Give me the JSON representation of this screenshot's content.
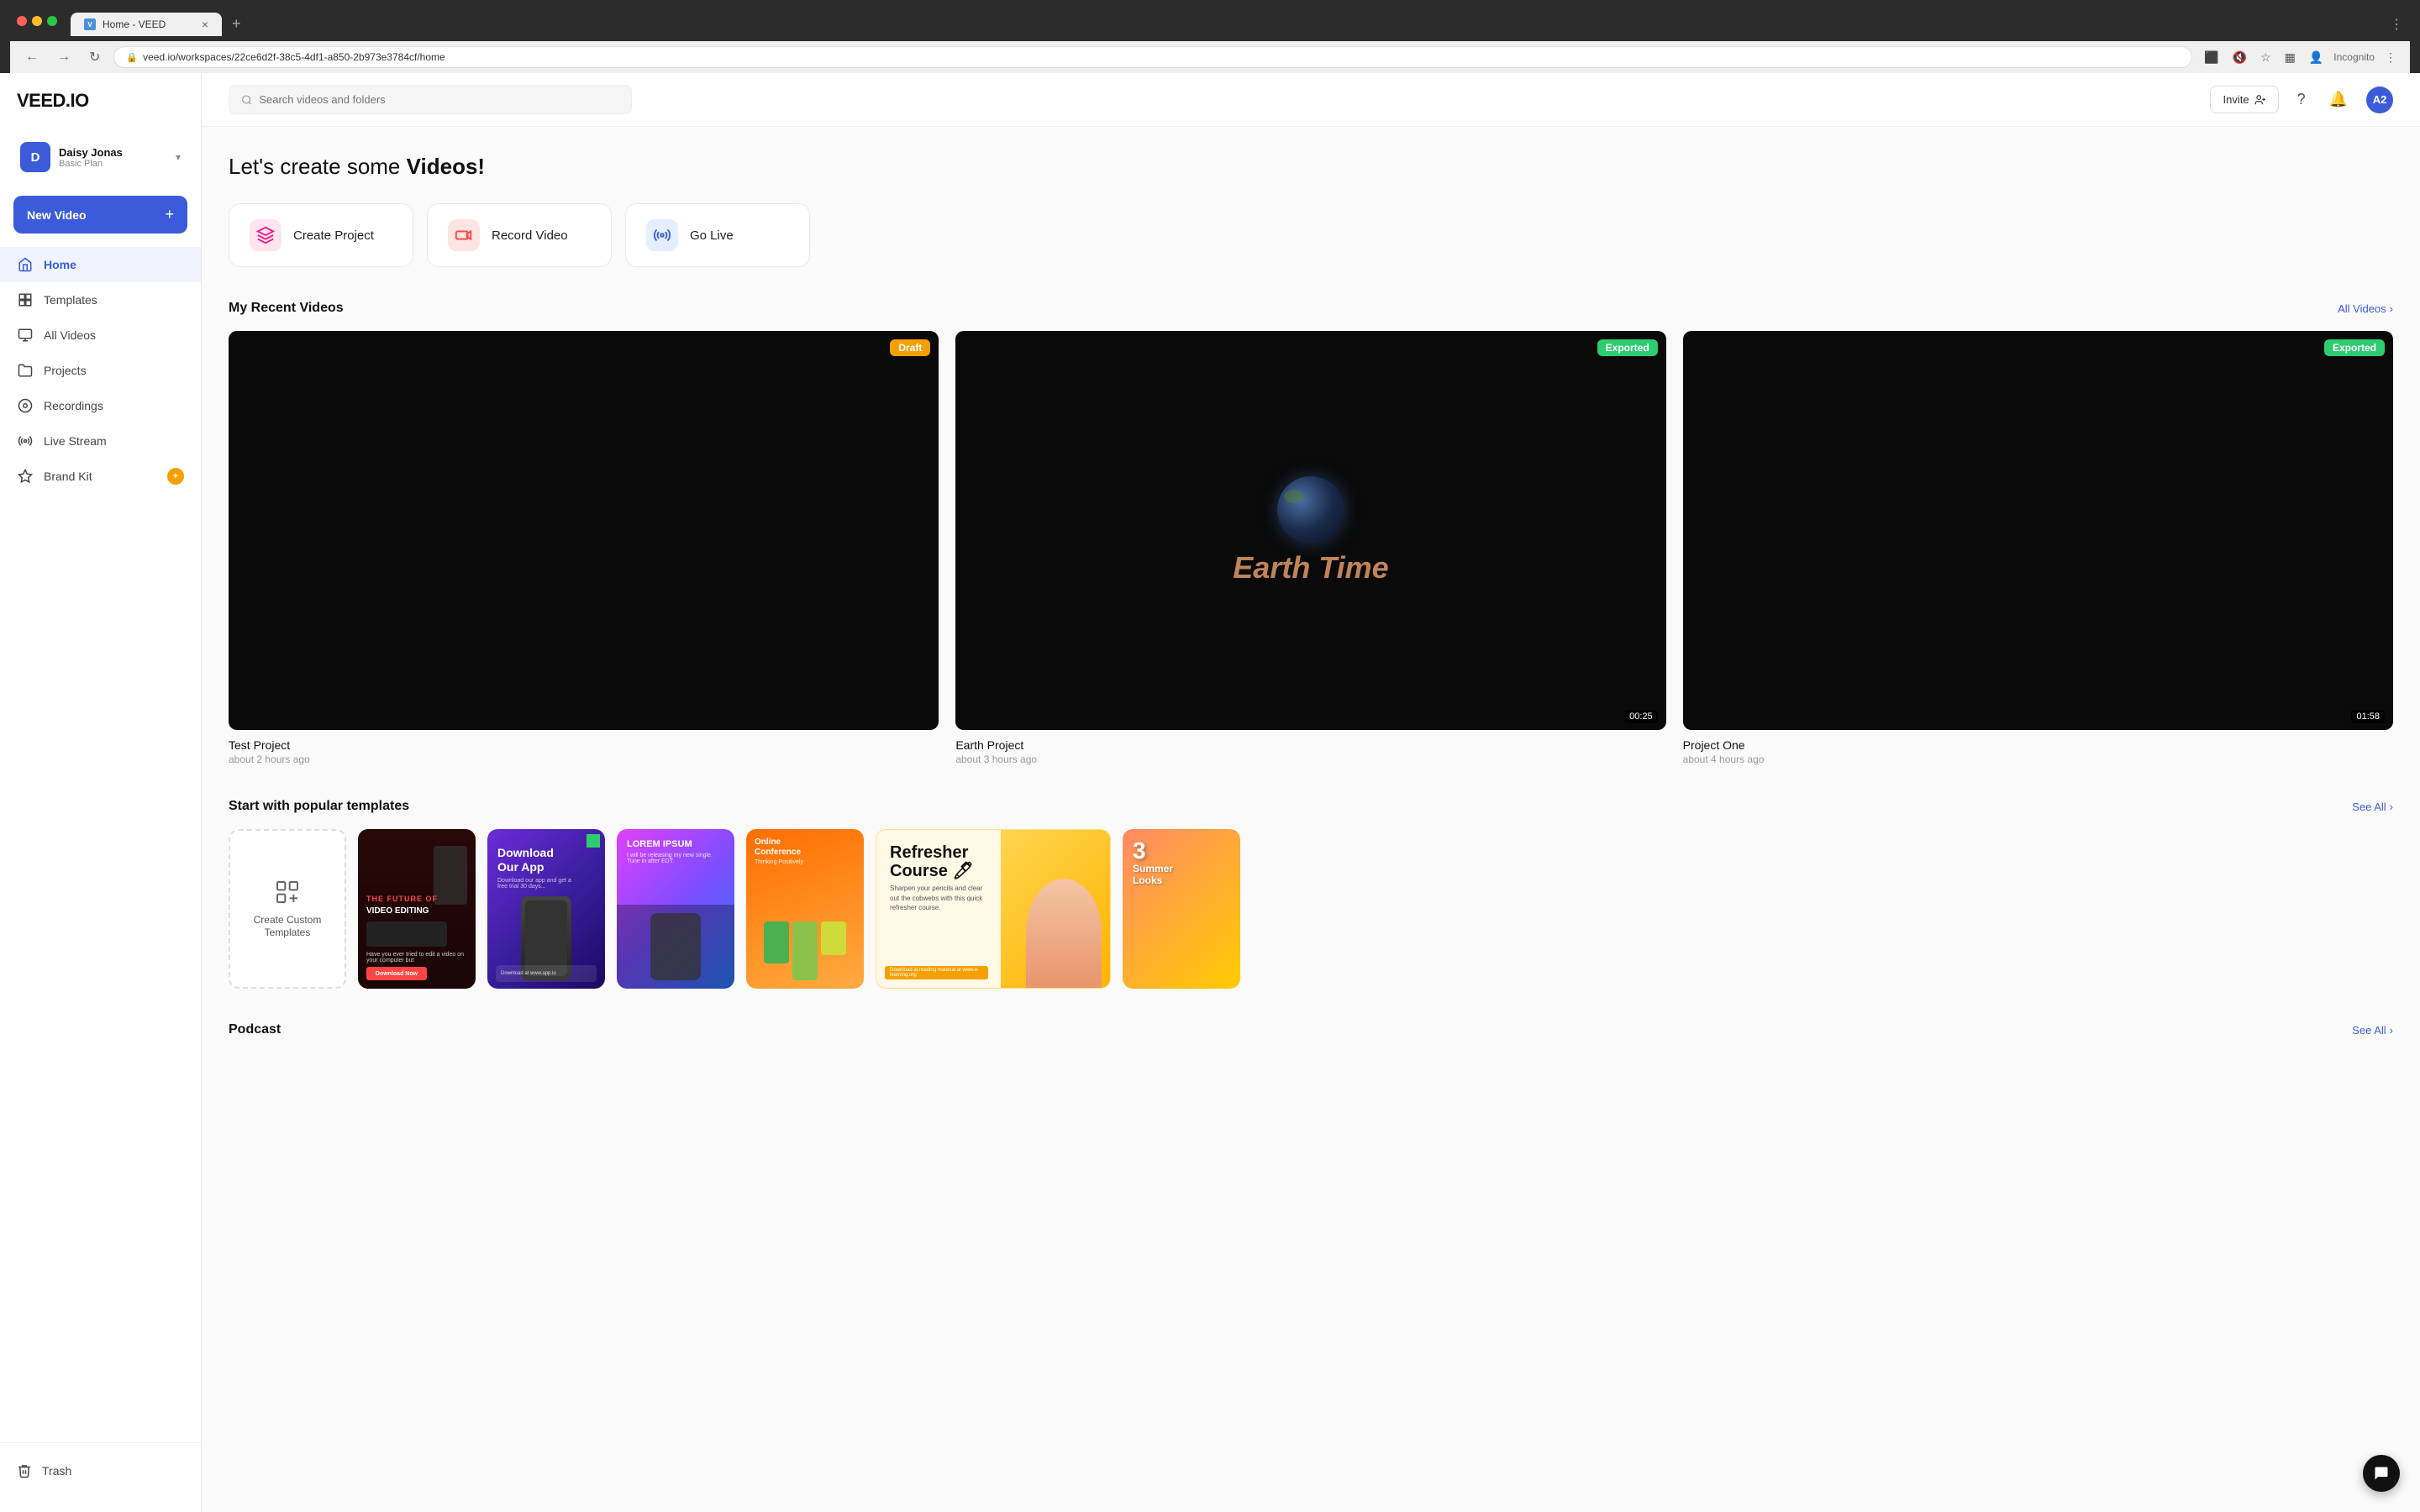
{
  "browser": {
    "tab_label": "Home - VEED",
    "tab_favicon": "V",
    "url": "veed.io/workspaces/22ce6d2f-38c5-4df1-a850-2b973e3784cf/home",
    "url_full": "https://veed.io/workspaces/22ce6d2f-38c5-4df1-a850-2b973e3784cf/home",
    "incognito_label": "Incognito"
  },
  "topbar": {
    "search_placeholder": "Search videos and folders",
    "invite_label": "Invite",
    "user_initials": "A2"
  },
  "sidebar": {
    "logo": "VEED.IO",
    "user": {
      "name": "Daisy Jonas",
      "plan": "Basic Plan",
      "initial": "D"
    },
    "new_video_label": "New Video",
    "nav_items": [
      {
        "id": "home",
        "label": "Home",
        "active": true
      },
      {
        "id": "templates",
        "label": "Templates",
        "active": false
      },
      {
        "id": "all-videos",
        "label": "All Videos",
        "active": false
      },
      {
        "id": "projects",
        "label": "Projects",
        "active": false
      },
      {
        "id": "recordings",
        "label": "Recordings",
        "active": false
      },
      {
        "id": "live-stream",
        "label": "Live Stream",
        "active": false
      },
      {
        "id": "brand-kit",
        "label": "Brand Kit",
        "active": false,
        "badge": "+"
      }
    ],
    "trash_label": "Trash"
  },
  "hero": {
    "title_part1": "Let's create some ",
    "title_part2": "Videos!"
  },
  "action_cards": [
    {
      "id": "create-project",
      "label": "Create Project",
      "icon": "✦"
    },
    {
      "id": "record-video",
      "label": "Record Video",
      "icon": "⬤"
    },
    {
      "id": "go-live",
      "label": "Go Live",
      "icon": "((·))"
    }
  ],
  "recent_videos": {
    "section_title": "My Recent Videos",
    "see_all_label": "All Videos",
    "items": [
      {
        "id": "test-project",
        "title": "Test Project",
        "time": "about 2 hours ago",
        "badge": "Draft",
        "badge_type": "draft",
        "has_duration": false
      },
      {
        "id": "earth-project",
        "title": "Earth Project",
        "time": "about 3 hours ago",
        "badge": "Exported",
        "badge_type": "exported",
        "has_duration": true,
        "duration": "00:25"
      },
      {
        "id": "project-one",
        "title": "Project One",
        "time": "about 4 hours ago",
        "badge": "Exported",
        "badge_type": "exported",
        "has_duration": true,
        "duration": "01:58"
      }
    ]
  },
  "templates": {
    "section_title": "Start with popular templates",
    "see_all_label": "See All",
    "create_custom_label": "Create Custom Templates",
    "items": [
      {
        "id": "future-video",
        "label": "The Future of Video Editing"
      },
      {
        "id": "download-app",
        "label": "Download Our App"
      },
      {
        "id": "lorem-ipsum",
        "label": "Lorem Ipsum"
      },
      {
        "id": "online-conference",
        "label": "Online Conference"
      },
      {
        "id": "refresher-course",
        "label": "Refresher Course"
      },
      {
        "id": "summer-looks",
        "label": "3 Summer Looks"
      }
    ]
  },
  "podcast": {
    "section_title": "Podcast",
    "see_all_label": "See All"
  }
}
